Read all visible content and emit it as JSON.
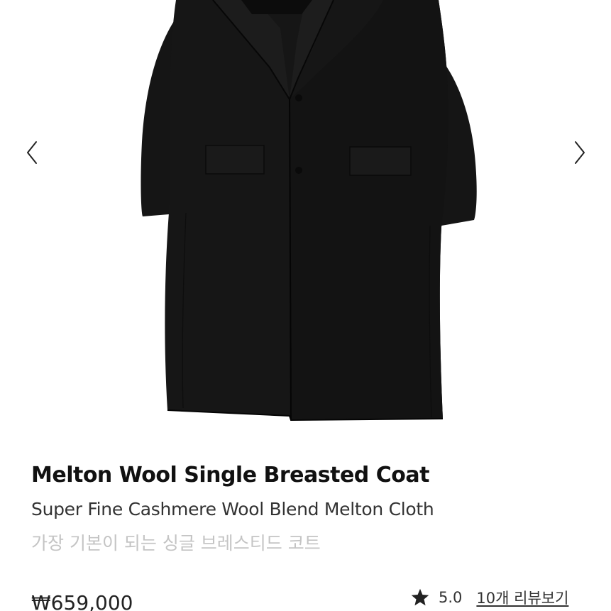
{
  "gallery": {
    "prev_icon": "chevron-left-icon",
    "next_icon": "chevron-right-icon"
  },
  "product": {
    "title": "Melton Wool Single Breasted Coat",
    "subtitle": "Super Fine Cashmere Wool Blend Melton Cloth",
    "description_ko": "가장 기본이 되는 싱글 브레스티드 코트",
    "price": "₩659,000",
    "rating": "5.0",
    "review_link": "10개 리뷰보기",
    "rating_icon": "star-icon",
    "colors": {
      "title": "#111111",
      "subtitle": "#333333",
      "description": "#c4c4c4",
      "coat": "#141414"
    }
  }
}
